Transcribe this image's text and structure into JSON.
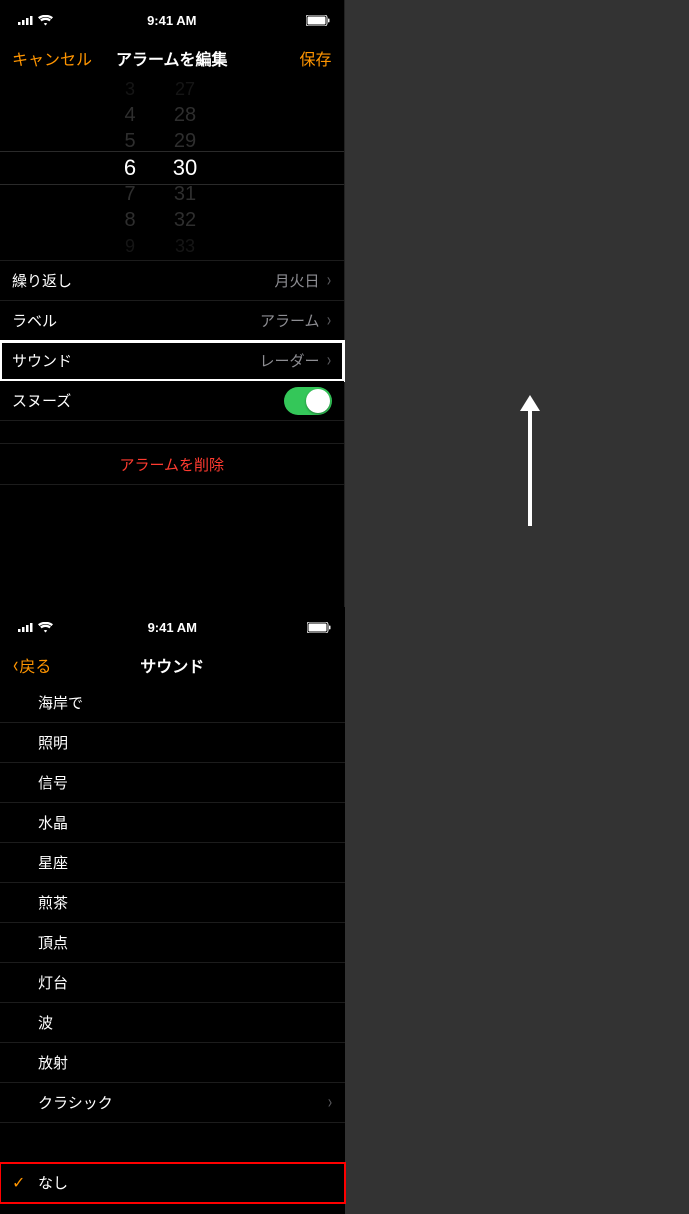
{
  "status": {
    "time": "9:41 AM"
  },
  "left": {
    "nav": {
      "cancel": "キャンセル",
      "title": "アラームを編集",
      "save": "保存"
    },
    "picker": {
      "hours": [
        "3",
        "4",
        "5",
        "6",
        "7",
        "8",
        "9"
      ],
      "mins": [
        "27",
        "28",
        "29",
        "30",
        "31",
        "32",
        "33"
      ]
    },
    "rows": {
      "repeat": {
        "label": "繰り返し",
        "value": "月火日"
      },
      "label": {
        "label": "ラベル",
        "value": "アラーム"
      },
      "sound": {
        "label": "サウンド",
        "value": "レーダー"
      },
      "snooze": {
        "label": "スヌーズ"
      }
    },
    "delete": "アラームを削除"
  },
  "right": {
    "nav": {
      "back": "戻る",
      "title": "サウンド"
    },
    "sounds": [
      "海岸で",
      "照明",
      "信号",
      "水晶",
      "星座",
      "煎茶",
      "頂点",
      "灯台",
      "波",
      "放射",
      "クラシック"
    ],
    "none": "なし"
  }
}
